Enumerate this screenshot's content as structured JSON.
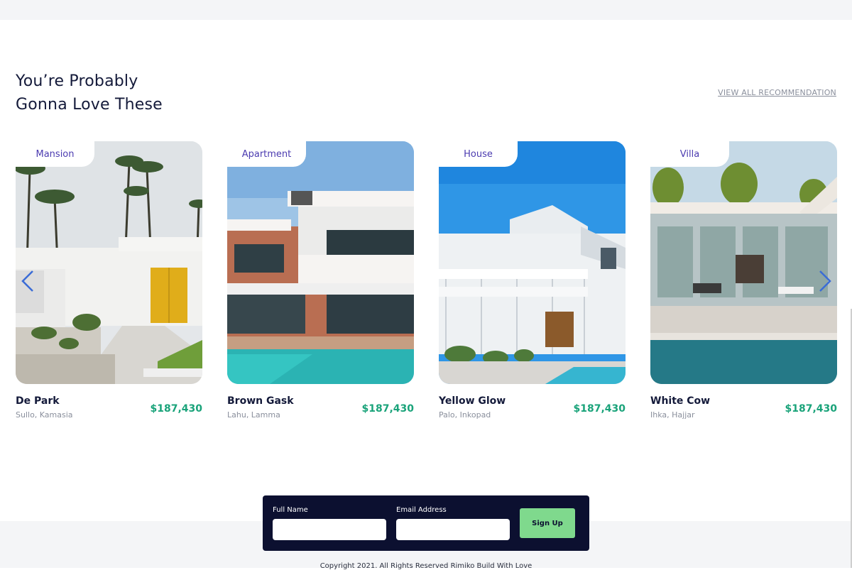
{
  "section": {
    "heading_line1": "You’re Probably",
    "heading_line2": "Gonna Love These",
    "view_all": "VIEW ALL RECOMMENDATION"
  },
  "cards": [
    {
      "tag": "Mansion",
      "name": "De Park",
      "location": "Sullo, Kamasia",
      "price": "$187,430",
      "image": "white modern house with yellow door and palm trees"
    },
    {
      "tag": "Apartment",
      "name": "Brown Gask",
      "location": "Lahu, Lamma",
      "price": "$187,430",
      "image": "modern villa with pool"
    },
    {
      "tag": "House",
      "name": "Yellow Glow",
      "location": "Palo, Inkopad",
      "price": "$187,430",
      "image": "white colonial house with porch and pool"
    },
    {
      "tag": "Villa",
      "name": "White Cow",
      "location": "Ihka, Hajjar",
      "price": "$187,430",
      "image": "glass pavilion with pool"
    }
  ],
  "carousel": {
    "prev_icon": "chevron-left-icon",
    "next_icon": "chevron-right-icon",
    "arrow_color": "#3b6cd6"
  },
  "signup": {
    "full_name_label": "Full Name",
    "email_label": "Email Address",
    "button_label": "Sign Up"
  },
  "footer": {
    "copyright": "Copyright 2021. All Rights Reserved Rimiko Build With Love"
  },
  "colors": {
    "accent_price": "#1aa37a",
    "tag_text": "#4b3bb0",
    "signup_bg": "#0c1030",
    "signup_button": "#7fd98d"
  }
}
